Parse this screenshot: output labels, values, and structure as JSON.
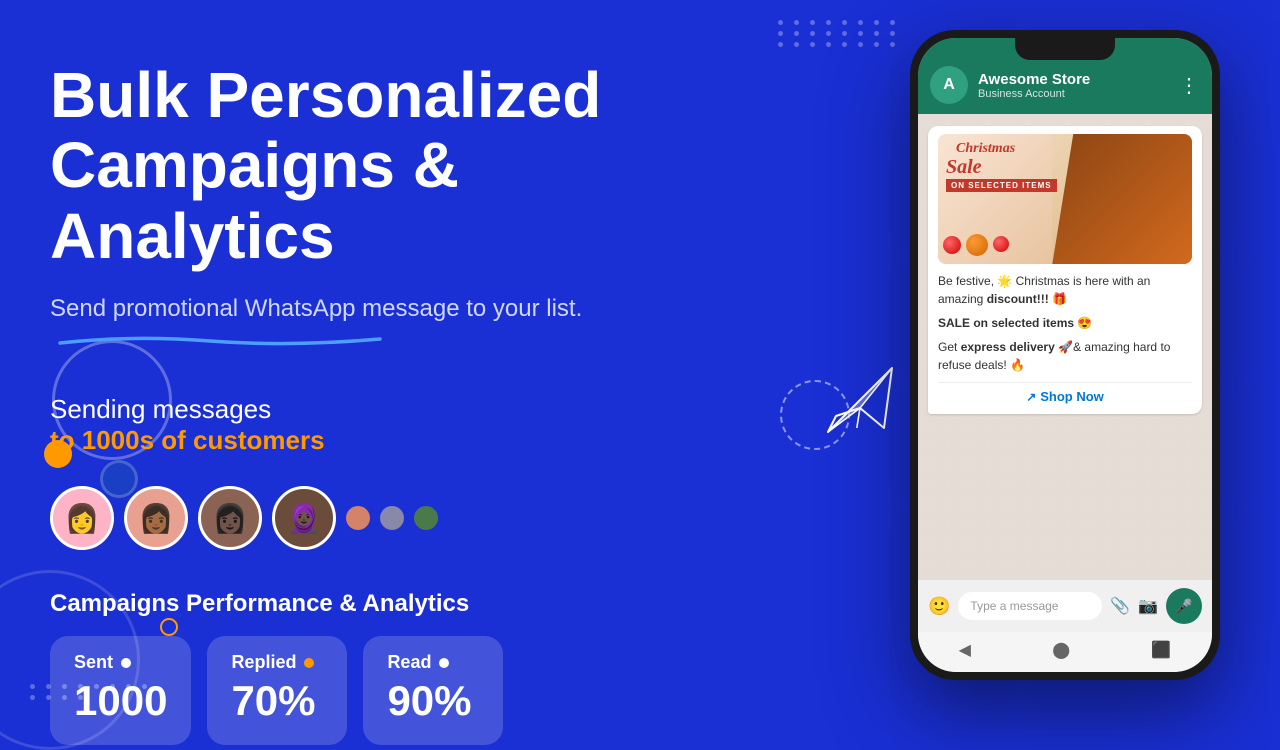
{
  "background": {
    "color": "#1a2fd4"
  },
  "hero": {
    "title_line1": "Bulk Personalized",
    "title_line2": "Campaigns & Analytics",
    "subtitle": "Send promotional WhatsApp message to your list.",
    "sending_label": "Sending messages",
    "sending_highlight": "to 1000s of customers"
  },
  "performance": {
    "title": "Campaigns Performance & Analytics",
    "stats": [
      {
        "label": "Sent",
        "value": "1000"
      },
      {
        "label": "Replied",
        "value": "70%"
      },
      {
        "label": "Read",
        "value": "90%"
      }
    ]
  },
  "phone": {
    "contact_name": "Awesome Store",
    "contact_status": "Business Account",
    "contact_initial": "A",
    "message_body_1": "Be festive, 🌟 Christmas is here with an amazing",
    "message_bold_1": "discount!!!",
    "message_emoji_1": "🎁",
    "sale_text": "SALE on selected items 😍",
    "message_body_2": "Get",
    "message_bold_2": "express delivery",
    "message_emoji_2": "🚀",
    "message_body_3": "& amazing hard to refuse deals! 🔥",
    "shop_now_label": "Shop Now",
    "input_placeholder": "Type a message",
    "image_text_line1": "Christmas",
    "image_text_line2": "Sale",
    "image_sub": "ON SELECTED ITEMS"
  },
  "avatars": [
    {
      "emoji": "👩",
      "bg": "#ffb3c6"
    },
    {
      "emoji": "👩🏾",
      "bg": "#e8a090"
    },
    {
      "emoji": "👩🏿",
      "bg": "#8b6355"
    },
    {
      "emoji": "🧕🏿",
      "bg": "#6b4c3b"
    }
  ],
  "dots": [
    {
      "color": "#d4826a"
    },
    {
      "color": "#8888aa"
    },
    {
      "color": "#4a7a4a"
    }
  ],
  "decorative": {
    "circle_outline_color": "rgba(255,255,255,0.3)",
    "orange_circle": "#ff9900",
    "blue_circle": "#1a3fc4"
  }
}
